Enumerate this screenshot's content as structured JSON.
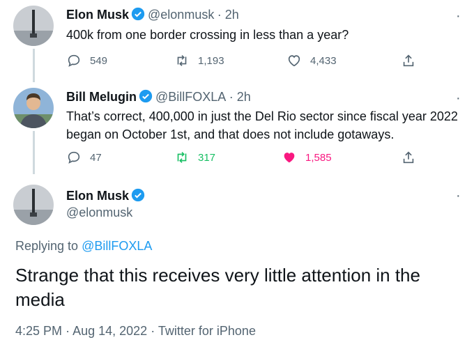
{
  "tweets": [
    {
      "name": "Elon Musk",
      "handle": "@elonmusk",
      "time": "· 2h",
      "text": "400k from one border crossing in less than a year?",
      "replies": "549",
      "retweets": "1,193",
      "likes": "4,433"
    },
    {
      "name": "Bill Melugin",
      "handle": "@BillFOXLA",
      "time": "· 2h",
      "text_line1": "That’s correct, 400,000 in just the Del Rio sector since fiscal year 2022",
      "text_line2": "began on October 1st, and that does not include gotaways.",
      "replies": "47",
      "retweets": "317",
      "likes": "1,585"
    }
  ],
  "main": {
    "name": "Elon Musk",
    "handle": "@elonmusk",
    "replying_prefix": "Replying to",
    "replying_to": "@BillFOXLA",
    "text_line1": "Strange that this receives very little attention in the",
    "text_line2": "media",
    "timestamp": "4:25 PM",
    "date": "Aug 14, 2022",
    "client": "Twitter for iPhone",
    "separator": "·"
  },
  "colors": {
    "verified": "#1d9bf0",
    "retweet_active": "#17bf63",
    "like_active": "#f91880"
  }
}
